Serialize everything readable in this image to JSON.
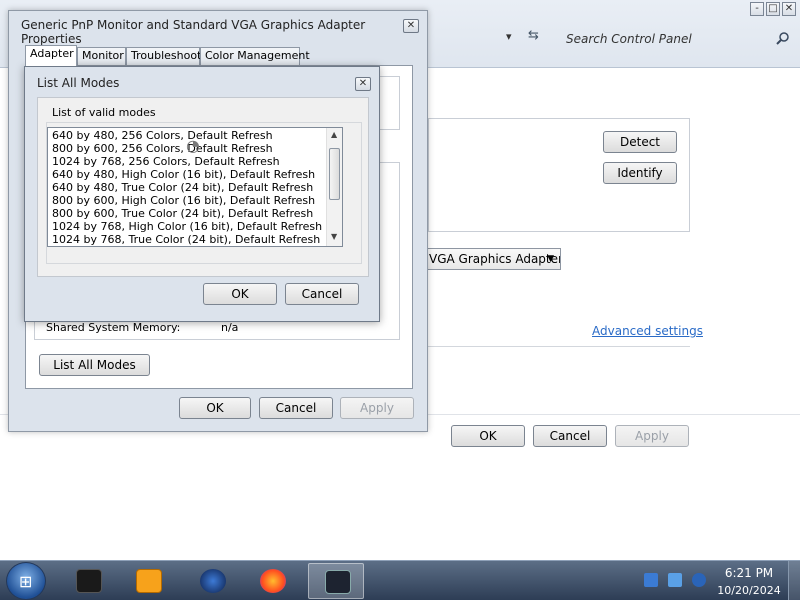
{
  "background_window": {
    "search_placeholder": "Search Control Panel",
    "nav_arrow": "▾",
    "detect_label": "Detect",
    "identify_label": "Identify",
    "adapter_select_value": "VGA Graphics Adapter",
    "advanced_link": "Advanced settings",
    "ok_label": "OK",
    "cancel_label": "Cancel",
    "apply_label": "Apply",
    "min_icon": "-",
    "max_icon": "□",
    "close_icon": "✕"
  },
  "properties_dialog": {
    "title": "Generic PnP Monitor and Standard VGA Graphics Adapter Properties",
    "tabs": [
      "Adapter",
      "Monitor",
      "Troubleshoot",
      "Color Management"
    ],
    "active_tab": "Adapter",
    "shared_memory_label": "Shared System Memory:",
    "shared_memory_value": "n/a",
    "list_all_modes_label": "List All Modes",
    "ok_label": "OK",
    "cancel_label": "Cancel",
    "apply_label": "Apply"
  },
  "modes_dialog": {
    "title": "List All Modes",
    "group_label": "List of valid modes",
    "modes": [
      "640 by 480, 256 Colors, Default Refresh",
      "800 by 600, 256 Colors, Default Refresh",
      "1024 by 768, 256 Colors, Default Refresh",
      "640 by 480, High Color (16 bit), Default Refresh",
      "640 by 480, True Color (24 bit), Default Refresh",
      "800 by 600, High Color (16 bit), Default Refresh",
      "800 by 600, True Color (24 bit), Default Refresh",
      "1024 by 768, High Color (16 bit), Default Refresh",
      "1024 by 768, True Color (24 bit), Default Refresh"
    ],
    "ok_label": "OK",
    "cancel_label": "Cancel"
  },
  "taskbar": {
    "time": "6:21 PM",
    "date": "10/20/2024",
    "items": [
      "terminal-icon",
      "media-player-icon",
      "firefox-dev-icon",
      "firefox-icon",
      "display-settings-icon"
    ],
    "colors": {
      "accent": "#2d3d55",
      "start_orb": "#1f4f95"
    }
  }
}
